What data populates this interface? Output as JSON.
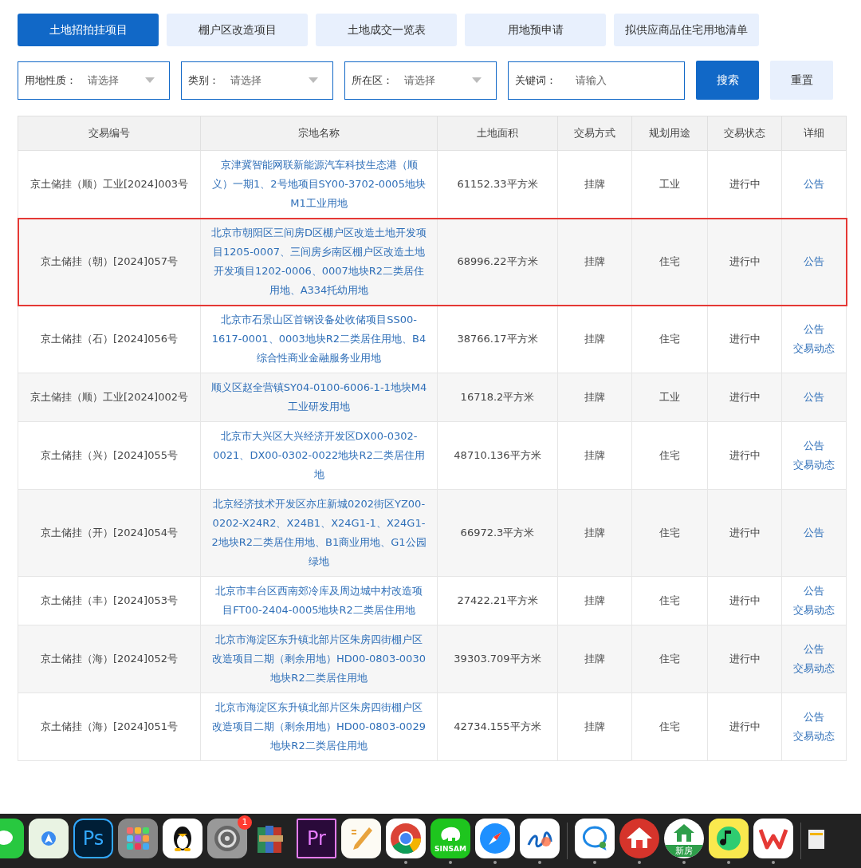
{
  "tabs": [
    {
      "label": "土地招拍挂项目",
      "selected": true
    },
    {
      "label": "棚户区改造项目",
      "selected": false
    },
    {
      "label": "土地成交一览表",
      "selected": false
    },
    {
      "label": "用地预申请",
      "selected": false
    },
    {
      "label": "拟供应商品住宅用地清单",
      "selected": false
    }
  ],
  "filters": [
    {
      "kind": "select",
      "label": "用地性质：",
      "placeholder": "请选择"
    },
    {
      "kind": "select",
      "label": "类别：",
      "placeholder": "请选择"
    },
    {
      "kind": "select",
      "label": "所在区：",
      "placeholder": "请选择"
    },
    {
      "kind": "text",
      "label": "关键词：",
      "placeholder": "请输入"
    }
  ],
  "buttons": [
    {
      "label": "搜索",
      "kind": "primary"
    },
    {
      "label": "重置",
      "kind": "secondary"
    }
  ],
  "table": {
    "columns": [
      "交易编号",
      "宗地名称",
      "土地面积",
      "交易方式",
      "规划用途",
      "交易状态",
      "详细"
    ],
    "rows": [
      {
        "highlighted": false,
        "cells": [
          "京土储挂（顺）工业[2024]003号",
          "京津冀智能网联新能源汽车科技生态港（顺义）一期1、2号地项目SY00-3702-0005地块M1工业用地",
          "61152.33平方米",
          "挂牌",
          "工业",
          "进行中"
        ],
        "links": [
          "公告"
        ]
      },
      {
        "highlighted": true,
        "cells": [
          "京土储挂（朝）[2024]057号",
          "北京市朝阳区三间房D区棚户区改造土地开发项目1205-0007、三间房乡南区棚户区改造土地开发项目1202-0006、0007地块R2二类居住用地、A334托幼用地",
          "68996.22平方米",
          "挂牌",
          "住宅",
          "进行中"
        ],
        "links": [
          "公告"
        ]
      },
      {
        "highlighted": false,
        "cells": [
          "京土储挂（石）[2024]056号",
          "北京市石景山区首钢设备处收储项目SS00-1617-0001、0003地块R2二类居住用地、B4综合性商业金融服务业用地",
          "38766.17平方米",
          "挂牌",
          "住宅",
          "进行中"
        ],
        "links": [
          "公告",
          "交易动态"
        ]
      },
      {
        "highlighted": false,
        "cells": [
          "京土储挂（顺）工业[2024]002号",
          "顺义区赵全营镇SY04-0100-6006-1-1地块M4工业研发用地",
          "16718.2平方米",
          "挂牌",
          "工业",
          "进行中"
        ],
        "links": [
          "公告"
        ]
      },
      {
        "highlighted": false,
        "cells": [
          "京土储挂（兴）[2024]055号",
          "北京市大兴区大兴经济开发区DX00-0302-0021、DX00-0302-0022地块R2二类居住用地",
          "48710.136平方米",
          "挂牌",
          "住宅",
          "进行中"
        ],
        "links": [
          "公告",
          "交易动态"
        ]
      },
      {
        "highlighted": false,
        "cells": [
          "京土储挂（开）[2024]054号",
          "北京经济技术开发区亦庄新城0202街区YZ00-0202-X24R2、X24B1、X24G1-1、X24G1-2地块R2二类居住用地、B1商业用地、G1公园绿地",
          "66972.3平方米",
          "挂牌",
          "住宅",
          "进行中"
        ],
        "links": [
          "公告"
        ]
      },
      {
        "highlighted": false,
        "cells": [
          "京土储挂（丰）[2024]053号",
          "北京市丰台区西南郊冷库及周边城中村改造项目FT00-2404-0005地块R2二类居住用地",
          "27422.21平方米",
          "挂牌",
          "住宅",
          "进行中"
        ],
        "links": [
          "公告",
          "交易动态"
        ]
      },
      {
        "highlighted": false,
        "cells": [
          "京土储挂（海）[2024]052号",
          "北京市海淀区东升镇北部片区朱房四街棚户区改造项目二期（剩余用地）HD00-0803-0030地块R2二类居住用地",
          "39303.709平方米",
          "挂牌",
          "住宅",
          "进行中"
        ],
        "links": [
          "公告",
          "交易动态"
        ]
      },
      {
        "highlighted": false,
        "cells": [
          "京土储挂（海）[2024]051号",
          "北京市海淀区东升镇北部片区朱房四街棚户区改造项目二期（剩余用地）HD00-0803-0029地块R2二类居住用地",
          "42734.155平方米",
          "挂牌",
          "住宅",
          "进行中"
        ],
        "links": [
          "公告",
          "交易动态"
        ]
      }
    ]
  },
  "dock": [
    {
      "kind": "chat",
      "running": false
    },
    {
      "kind": "maps",
      "running": false
    },
    {
      "kind": "ps",
      "label": "Ps",
      "running": false
    },
    {
      "kind": "grid",
      "running": false
    },
    {
      "kind": "penguin",
      "running": false
    },
    {
      "kind": "gear",
      "badge": "1",
      "running": false
    },
    {
      "kind": "books",
      "running": false
    },
    {
      "kind": "pr",
      "label": "Pr",
      "running": false
    },
    {
      "kind": "pen",
      "running": false
    },
    {
      "kind": "chrome",
      "running": true
    },
    {
      "kind": "elephant",
      "label": "SINSAM",
      "running": true
    },
    {
      "kind": "compass",
      "running": true
    },
    {
      "kind": "scribble",
      "running": true
    },
    {
      "kind": "separator"
    },
    {
      "kind": "bubble",
      "running": true
    },
    {
      "kind": "roof",
      "running": true
    },
    {
      "kind": "house",
      "label": "新房",
      "running": true
    },
    {
      "kind": "note",
      "running": true
    },
    {
      "kind": "wps",
      "running": true
    },
    {
      "kind": "separator"
    },
    {
      "kind": "folder",
      "running": false
    }
  ]
}
